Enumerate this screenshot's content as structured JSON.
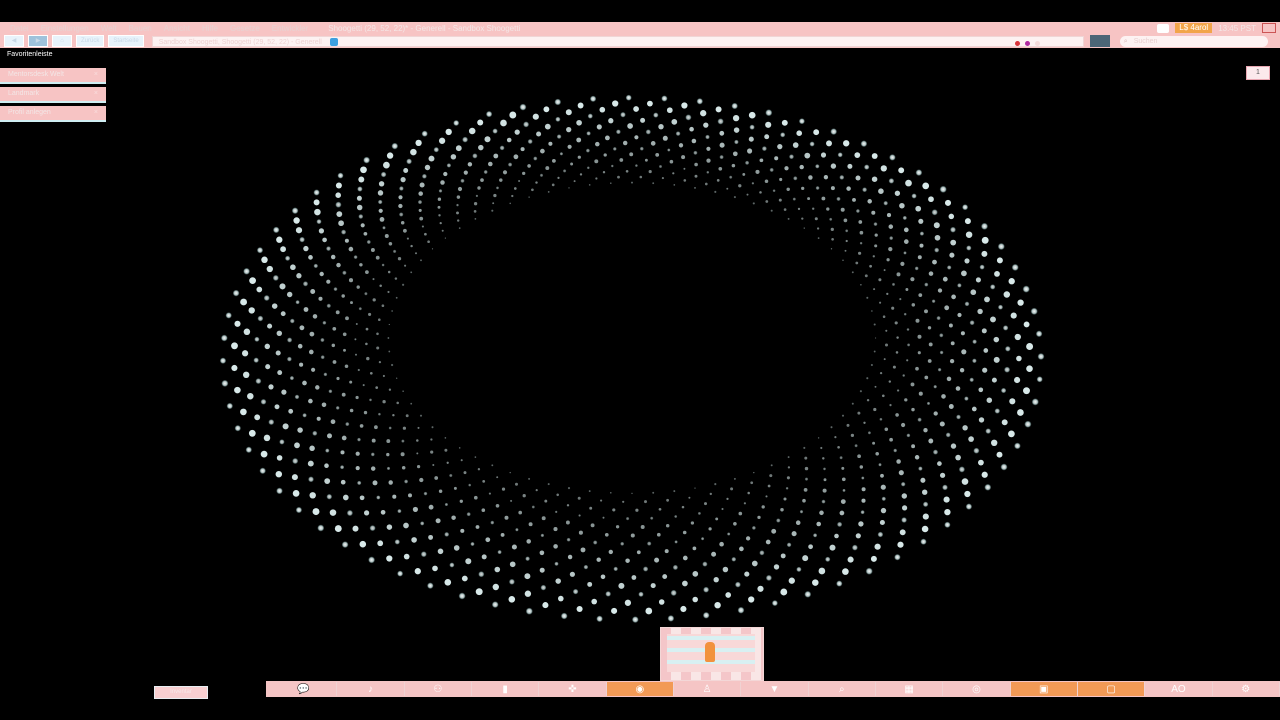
{
  "menubar": {
    "items": [
      "Datei",
      "Einstellungen",
      "Welt",
      "Bauen",
      "Ansicht",
      "Hilfe",
      "Gesetze",
      "Entwickler"
    ],
    "window_title": "Shoogetti (29, 52, 22)* - Generell - Sandbox Shoogetti",
    "status_field": "",
    "energy": "L$ 4arol",
    "clock": "13:45 PST"
  },
  "navbar": {
    "button_label_1": "Zurück",
    "button_label_2": "Startseite",
    "address": "Sandbox Shoogetti, Shoogetti (29, 52, 22) - Generell",
    "search_placeholder": "Suchen"
  },
  "favorites": {
    "title": "Favoritenleiste",
    "items": [
      {
        "label": "Mentorsdesk Welt"
      },
      {
        "label": "Landmark"
      },
      {
        "label": "Profil anlegen"
      }
    ]
  },
  "corner_button": "1",
  "bottom_left_button": "Inventar",
  "toolbar": {
    "icons": [
      "chat-icon",
      "speak-icon",
      "people-icon",
      "places-icon",
      "walk-icon",
      "view-icon",
      "fly-icon",
      "build-icon",
      "search-icon",
      "map-icon",
      "minimap-icon",
      "snapshot-icon",
      "inventory-icon",
      "ao-icon",
      "settings-icon"
    ],
    "ao_label": "AO"
  },
  "colors": {
    "chrome_pink": "#f7c4c4",
    "active_orange": "#f29a56",
    "star_glow": "#dff6f6",
    "background": "#000000"
  }
}
